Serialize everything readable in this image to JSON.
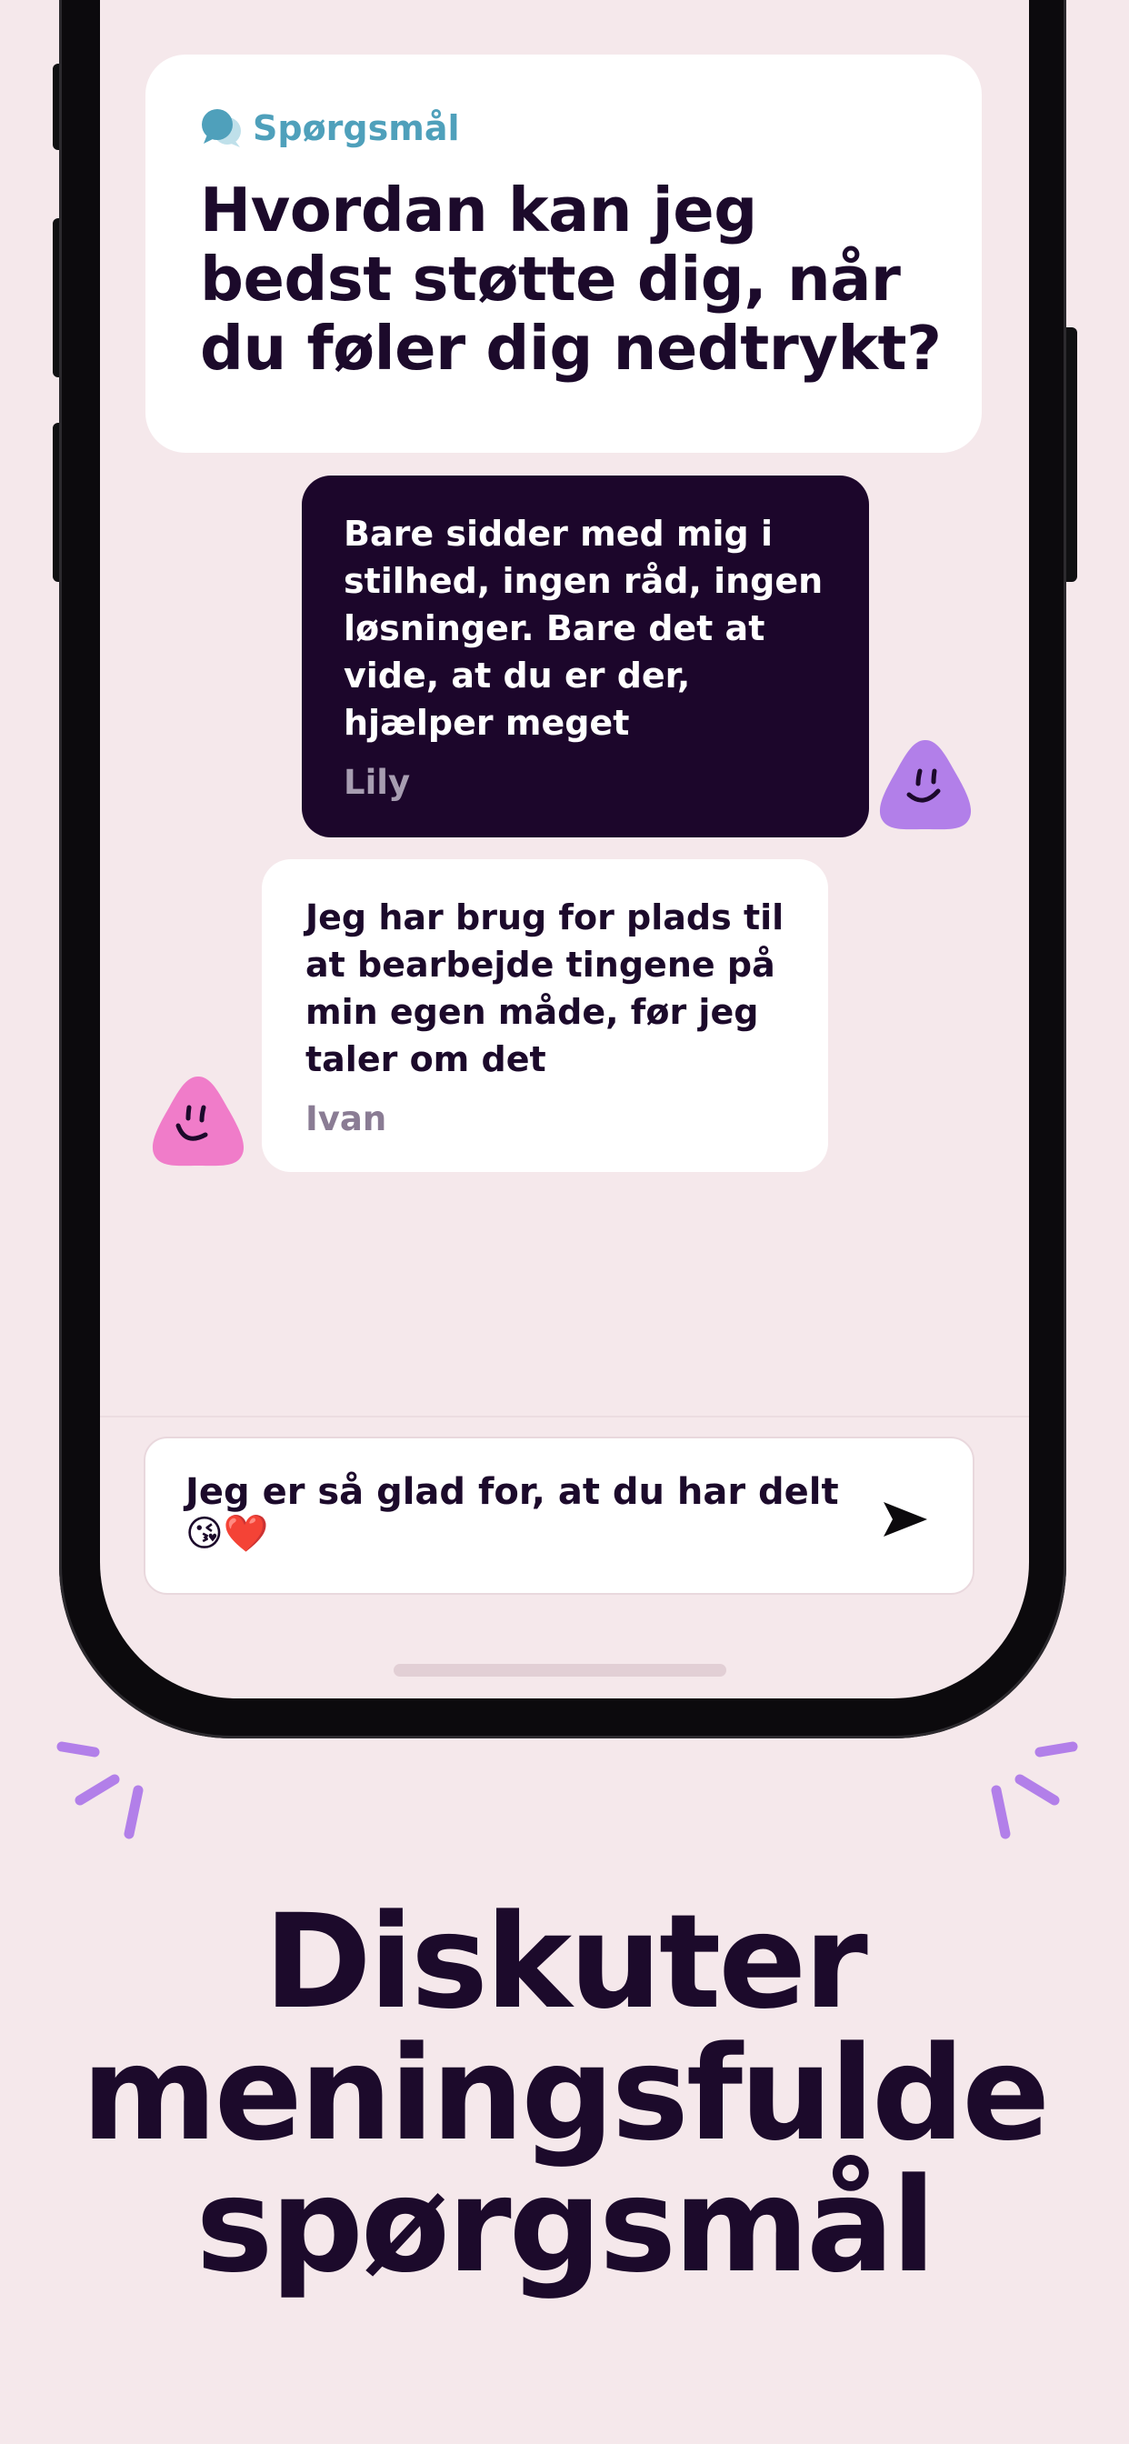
{
  "question": {
    "tag": "Spørgsmål",
    "icon": "speech-bubbles-icon",
    "title": "Hvordan kan jeg bedst støtte dig, når du føler dig nedtrykt?"
  },
  "messages": [
    {
      "text": "Bare sidder med mig i stilhed, ingen råd, ingen løsninger. Bare det at vide, at du er der, hjælper meget",
      "author": "Lily",
      "avatar_color": "#b27fe9"
    },
    {
      "text": "Jeg har brug for plads til at bearbejde tingene på min egen måde, før jeg taler om det",
      "author": "Ivan",
      "avatar_color": "#f07cc9"
    }
  ],
  "composer": {
    "text": "Jeg er så glad for, at du har delt 😘❤️",
    "send_icon": "send-arrow-icon"
  },
  "headline": {
    "lines": [
      "Diskuter",
      "meningsfulde",
      "spørgsmål"
    ]
  },
  "colors": {
    "background": "#f5e8eb",
    "ink": "#1c0a2b",
    "dark_bubble": "#1c062b",
    "accent_teal": "#4fa0bb",
    "accent_purple": "#b27fe9",
    "accent_pink": "#f07cc9"
  }
}
